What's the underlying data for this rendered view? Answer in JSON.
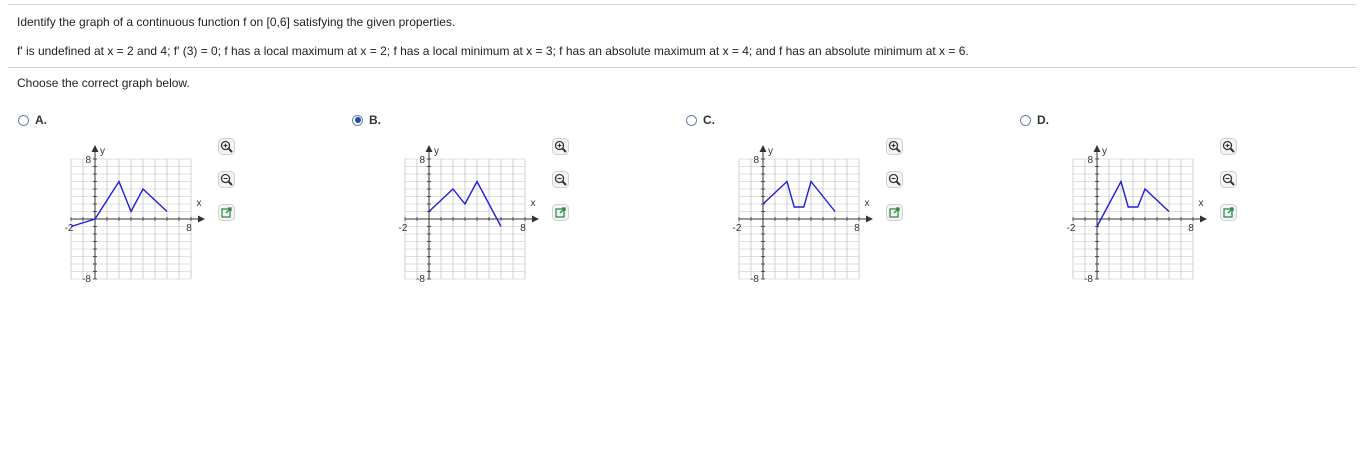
{
  "question": {
    "prompt": "Identify the graph of a continuous function f on [0,6] satisfying the given properties.",
    "properties": "f' is undefined at x = 2 and 4; f' (3) = 0; f has a local maximum at x = 2; f has a local minimum at x = 3; f has an absolute maximum at x = 4; and f has an absolute minimum at x = 6.",
    "instruction": "Choose the correct graph below."
  },
  "choices": [
    {
      "label": "A.",
      "selected": false,
      "points": [
        [
          -2,
          -1
        ],
        [
          0,
          0
        ],
        [
          2,
          5
        ],
        [
          3,
          1
        ],
        [
          4,
          4
        ],
        [
          6,
          1
        ]
      ]
    },
    {
      "label": "B.",
      "selected": true,
      "points": [
        [
          0,
          1
        ],
        [
          2,
          4
        ],
        [
          3,
          2
        ],
        [
          4,
          5
        ],
        [
          6,
          -1
        ]
      ]
    },
    {
      "label": "C.",
      "selected": false,
      "points": [
        [
          0,
          2
        ],
        [
          2,
          5
        ],
        [
          2.6,
          1.6
        ],
        [
          3.4,
          1.6
        ],
        [
          4,
          5
        ],
        [
          6,
          1
        ]
      ]
    },
    {
      "label": "D.",
      "selected": false,
      "points": [
        [
          0,
          -1
        ],
        [
          2,
          5
        ],
        [
          2.6,
          1.6
        ],
        [
          3.4,
          1.6
        ],
        [
          4,
          4
        ],
        [
          6,
          1
        ]
      ]
    }
  ],
  "axes": {
    "xlabel": "x",
    "ylabel": "y",
    "xmin_label": "-2",
    "xmax_label": "8",
    "ymax_label": "8",
    "ymin_label": "-8",
    "xlim": [
      -2,
      8
    ],
    "ylim": [
      -8,
      8
    ]
  },
  "icons": {
    "zoom_in": "zoom-in-icon",
    "zoom_out": "zoom-out-icon",
    "popout": "popout-icon"
  },
  "colors": {
    "curve": "#1f1fd6",
    "grid": "#c4c4c4",
    "radio_selected": "#1c4fa3",
    "tool_accent": "#2f8a4c"
  }
}
